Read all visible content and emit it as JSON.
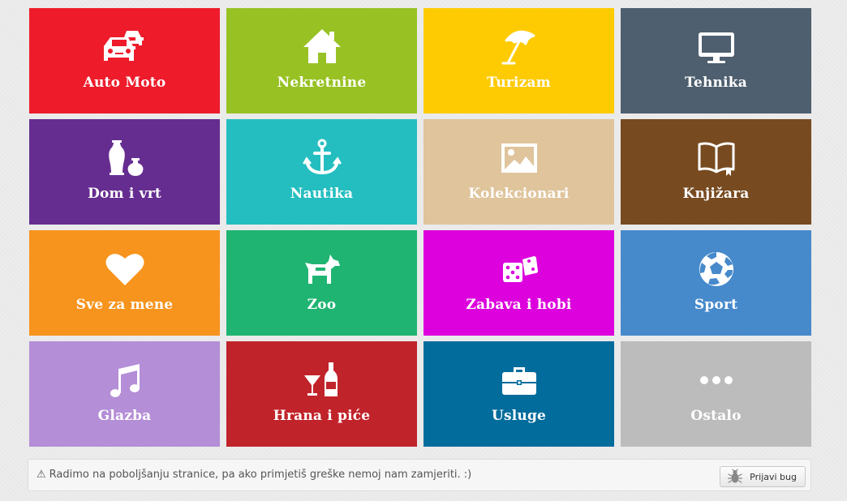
{
  "categories": [
    {
      "label": "Auto Moto",
      "color": "#ee1c2b",
      "icon": "cars-icon"
    },
    {
      "label": "Nekretnine",
      "color": "#98c224",
      "icon": "house-icon"
    },
    {
      "label": "Turizam",
      "color": "#fecb02",
      "icon": "beach-umbrella-icon"
    },
    {
      "label": "Tehnika",
      "color": "#4e5f6f",
      "icon": "monitor-icon"
    },
    {
      "label": "Dom i vrt",
      "color": "#662d91",
      "icon": "vases-icon"
    },
    {
      "label": "Nautika",
      "color": "#25bec0",
      "icon": "anchor-icon"
    },
    {
      "label": "Kolekcionari",
      "color": "#dfc49c",
      "icon": "picture-icon"
    },
    {
      "label": "Knjižara",
      "color": "#774a20",
      "icon": "open-book-icon"
    },
    {
      "label": "Sve za mene",
      "color": "#f7941d",
      "icon": "heart-icon"
    },
    {
      "label": "Zoo",
      "color": "#20b473",
      "icon": "dog-icon"
    },
    {
      "label": "Zabava i hobi",
      "color": "#dc01dd",
      "icon": "dice-icon"
    },
    {
      "label": "Sport",
      "color": "#478acc",
      "icon": "soccer-ball-icon"
    },
    {
      "label": "Glazba",
      "color": "#b48ed6",
      "icon": "music-note-icon"
    },
    {
      "label": "Hrana i piće",
      "color": "#c1232a",
      "icon": "glass-bottle-icon"
    },
    {
      "label": "Usluge",
      "color": "#026c9c",
      "icon": "briefcase-icon"
    },
    {
      "label": "Ostalo",
      "color": "#bdbcbd",
      "icon": "more-dots-icon"
    }
  ],
  "notice": {
    "text": "Radimo na poboljšanju stranice, pa ako primjetiš greške nemoj nam zamjeriti. :)",
    "warning_icon": "warning-icon",
    "button_label": "Prijavi bug",
    "button_icon": "bug-icon"
  }
}
